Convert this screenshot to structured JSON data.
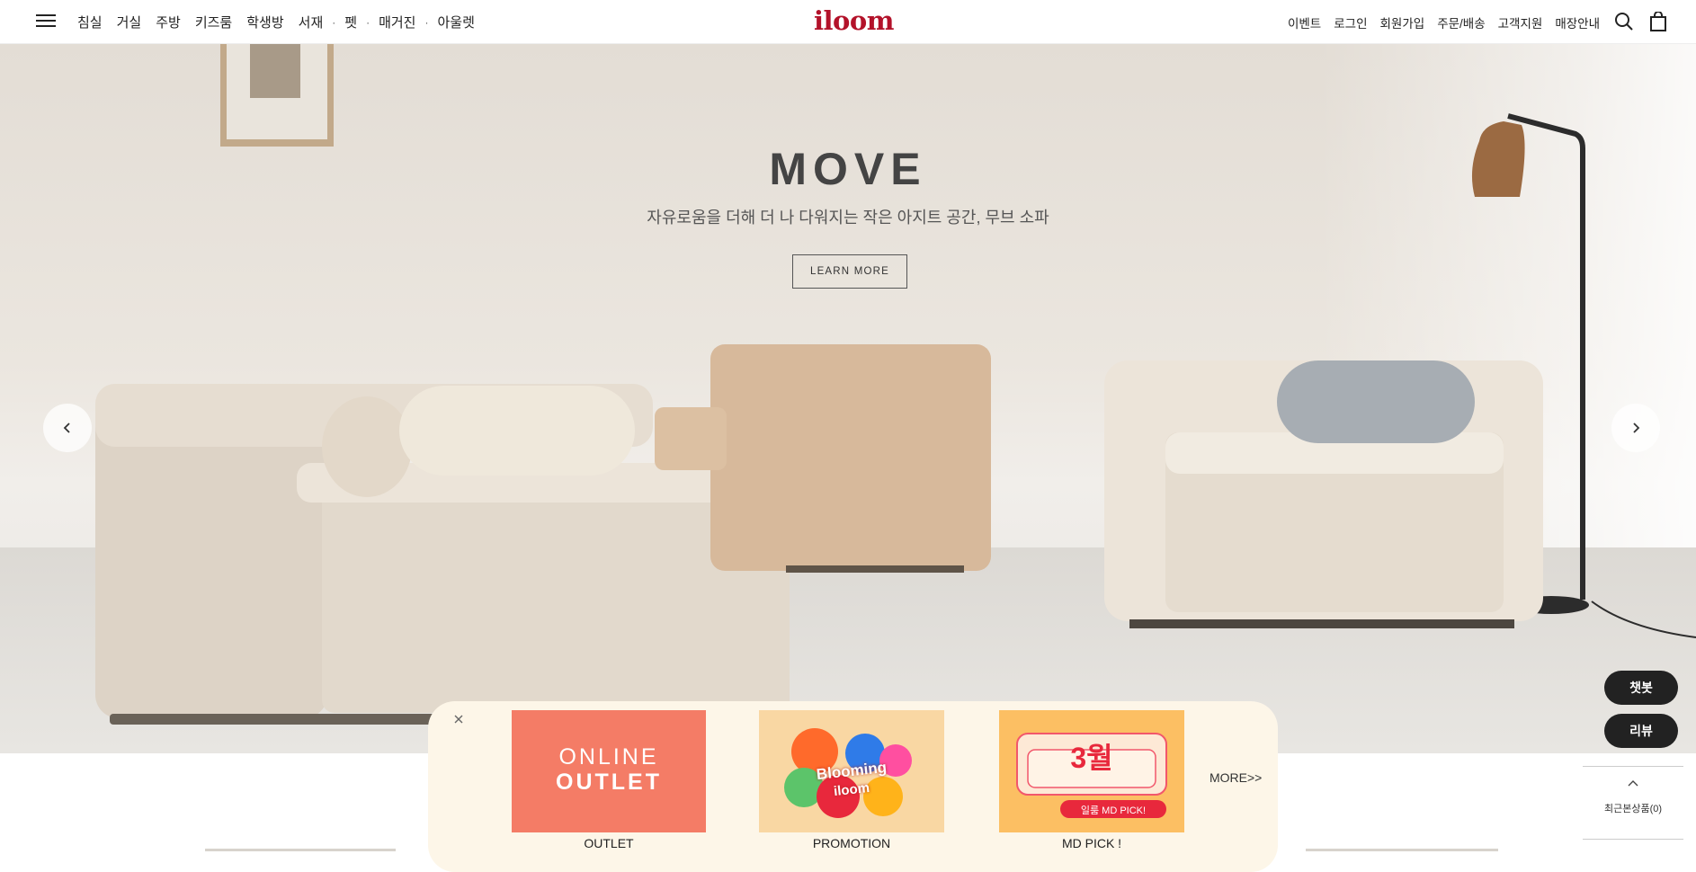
{
  "header": {
    "menu": [
      "침실",
      "거실",
      "주방",
      "키즈룸",
      "학생방",
      "서재",
      "펫",
      "매거진",
      "아울렛"
    ],
    "logo": "iloom",
    "util": [
      "이벤트",
      "로그인",
      "회원가입",
      "주문/배송",
      "고객지원",
      "매장안내"
    ]
  },
  "hero": {
    "title": "MOVE",
    "subtitle": "자유로움을 더해 더 나 다워지는 작은 아지트 공간, 무브 소파",
    "cta": "LEARN MORE"
  },
  "side": {
    "chatbot": "챗봇",
    "review": "리뷰",
    "recent": "최근본상품(0)"
  },
  "promo": {
    "cards": [
      {
        "label": "OUTLET",
        "line1": "ONLINE",
        "line2": "OUTLET"
      },
      {
        "label": "PROMOTION",
        "art_top": "Blooming",
        "art_bottom": "iloom"
      },
      {
        "label": "MD PICK !",
        "month": "3월",
        "tag": "일룸 MD PICK!"
      }
    ],
    "more": "MORE>>"
  },
  "colors": {
    "brand": "#b3122a",
    "outlet_bg": "#f47c66",
    "promo_panel": "#fdf6e8",
    "mdpick_bg": "#fcbf63"
  }
}
